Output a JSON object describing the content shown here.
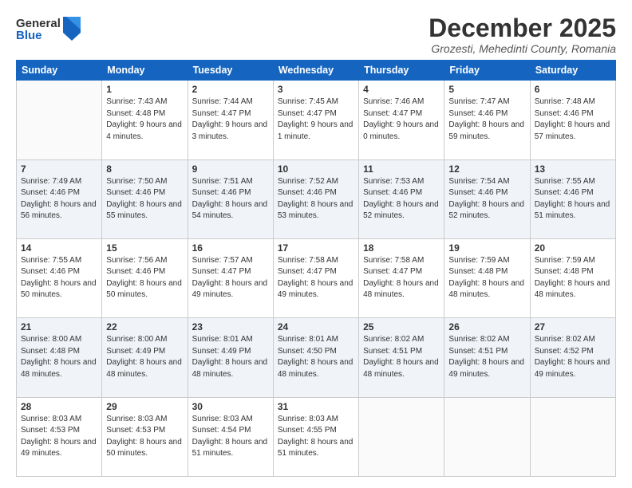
{
  "logo": {
    "general": "General",
    "blue": "Blue"
  },
  "header": {
    "month": "December 2025",
    "location": "Grozesti, Mehedinti County, Romania"
  },
  "weekdays": [
    "Sunday",
    "Monday",
    "Tuesday",
    "Wednesday",
    "Thursday",
    "Friday",
    "Saturday"
  ],
  "weeks": [
    [
      {
        "day": "",
        "sunrise": "",
        "sunset": "",
        "daylight": ""
      },
      {
        "day": "1",
        "sunrise": "Sunrise: 7:43 AM",
        "sunset": "Sunset: 4:48 PM",
        "daylight": "Daylight: 9 hours and 4 minutes."
      },
      {
        "day": "2",
        "sunrise": "Sunrise: 7:44 AM",
        "sunset": "Sunset: 4:47 PM",
        "daylight": "Daylight: 9 hours and 3 minutes."
      },
      {
        "day": "3",
        "sunrise": "Sunrise: 7:45 AM",
        "sunset": "Sunset: 4:47 PM",
        "daylight": "Daylight: 9 hours and 1 minute."
      },
      {
        "day": "4",
        "sunrise": "Sunrise: 7:46 AM",
        "sunset": "Sunset: 4:47 PM",
        "daylight": "Daylight: 9 hours and 0 minutes."
      },
      {
        "day": "5",
        "sunrise": "Sunrise: 7:47 AM",
        "sunset": "Sunset: 4:46 PM",
        "daylight": "Daylight: 8 hours and 59 minutes."
      },
      {
        "day": "6",
        "sunrise": "Sunrise: 7:48 AM",
        "sunset": "Sunset: 4:46 PM",
        "daylight": "Daylight: 8 hours and 57 minutes."
      }
    ],
    [
      {
        "day": "7",
        "sunrise": "Sunrise: 7:49 AM",
        "sunset": "Sunset: 4:46 PM",
        "daylight": "Daylight: 8 hours and 56 minutes."
      },
      {
        "day": "8",
        "sunrise": "Sunrise: 7:50 AM",
        "sunset": "Sunset: 4:46 PM",
        "daylight": "Daylight: 8 hours and 55 minutes."
      },
      {
        "day": "9",
        "sunrise": "Sunrise: 7:51 AM",
        "sunset": "Sunset: 4:46 PM",
        "daylight": "Daylight: 8 hours and 54 minutes."
      },
      {
        "day": "10",
        "sunrise": "Sunrise: 7:52 AM",
        "sunset": "Sunset: 4:46 PM",
        "daylight": "Daylight: 8 hours and 53 minutes."
      },
      {
        "day": "11",
        "sunrise": "Sunrise: 7:53 AM",
        "sunset": "Sunset: 4:46 PM",
        "daylight": "Daylight: 8 hours and 52 minutes."
      },
      {
        "day": "12",
        "sunrise": "Sunrise: 7:54 AM",
        "sunset": "Sunset: 4:46 PM",
        "daylight": "Daylight: 8 hours and 52 minutes."
      },
      {
        "day": "13",
        "sunrise": "Sunrise: 7:55 AM",
        "sunset": "Sunset: 4:46 PM",
        "daylight": "Daylight: 8 hours and 51 minutes."
      }
    ],
    [
      {
        "day": "14",
        "sunrise": "Sunrise: 7:55 AM",
        "sunset": "Sunset: 4:46 PM",
        "daylight": "Daylight: 8 hours and 50 minutes."
      },
      {
        "day": "15",
        "sunrise": "Sunrise: 7:56 AM",
        "sunset": "Sunset: 4:46 PM",
        "daylight": "Daylight: 8 hours and 50 minutes."
      },
      {
        "day": "16",
        "sunrise": "Sunrise: 7:57 AM",
        "sunset": "Sunset: 4:47 PM",
        "daylight": "Daylight: 8 hours and 49 minutes."
      },
      {
        "day": "17",
        "sunrise": "Sunrise: 7:58 AM",
        "sunset": "Sunset: 4:47 PM",
        "daylight": "Daylight: 8 hours and 49 minutes."
      },
      {
        "day": "18",
        "sunrise": "Sunrise: 7:58 AM",
        "sunset": "Sunset: 4:47 PM",
        "daylight": "Daylight: 8 hours and 48 minutes."
      },
      {
        "day": "19",
        "sunrise": "Sunrise: 7:59 AM",
        "sunset": "Sunset: 4:48 PM",
        "daylight": "Daylight: 8 hours and 48 minutes."
      },
      {
        "day": "20",
        "sunrise": "Sunrise: 7:59 AM",
        "sunset": "Sunset: 4:48 PM",
        "daylight": "Daylight: 8 hours and 48 minutes."
      }
    ],
    [
      {
        "day": "21",
        "sunrise": "Sunrise: 8:00 AM",
        "sunset": "Sunset: 4:48 PM",
        "daylight": "Daylight: 8 hours and 48 minutes."
      },
      {
        "day": "22",
        "sunrise": "Sunrise: 8:00 AM",
        "sunset": "Sunset: 4:49 PM",
        "daylight": "Daylight: 8 hours and 48 minutes."
      },
      {
        "day": "23",
        "sunrise": "Sunrise: 8:01 AM",
        "sunset": "Sunset: 4:49 PM",
        "daylight": "Daylight: 8 hours and 48 minutes."
      },
      {
        "day": "24",
        "sunrise": "Sunrise: 8:01 AM",
        "sunset": "Sunset: 4:50 PM",
        "daylight": "Daylight: 8 hours and 48 minutes."
      },
      {
        "day": "25",
        "sunrise": "Sunrise: 8:02 AM",
        "sunset": "Sunset: 4:51 PM",
        "daylight": "Daylight: 8 hours and 48 minutes."
      },
      {
        "day": "26",
        "sunrise": "Sunrise: 8:02 AM",
        "sunset": "Sunset: 4:51 PM",
        "daylight": "Daylight: 8 hours and 49 minutes."
      },
      {
        "day": "27",
        "sunrise": "Sunrise: 8:02 AM",
        "sunset": "Sunset: 4:52 PM",
        "daylight": "Daylight: 8 hours and 49 minutes."
      }
    ],
    [
      {
        "day": "28",
        "sunrise": "Sunrise: 8:03 AM",
        "sunset": "Sunset: 4:53 PM",
        "daylight": "Daylight: 8 hours and 49 minutes."
      },
      {
        "day": "29",
        "sunrise": "Sunrise: 8:03 AM",
        "sunset": "Sunset: 4:53 PM",
        "daylight": "Daylight: 8 hours and 50 minutes."
      },
      {
        "day": "30",
        "sunrise": "Sunrise: 8:03 AM",
        "sunset": "Sunset: 4:54 PM",
        "daylight": "Daylight: 8 hours and 51 minutes."
      },
      {
        "day": "31",
        "sunrise": "Sunrise: 8:03 AM",
        "sunset": "Sunset: 4:55 PM",
        "daylight": "Daylight: 8 hours and 51 minutes."
      },
      {
        "day": "",
        "sunrise": "",
        "sunset": "",
        "daylight": ""
      },
      {
        "day": "",
        "sunrise": "",
        "sunset": "",
        "daylight": ""
      },
      {
        "day": "",
        "sunrise": "",
        "sunset": "",
        "daylight": ""
      }
    ]
  ]
}
